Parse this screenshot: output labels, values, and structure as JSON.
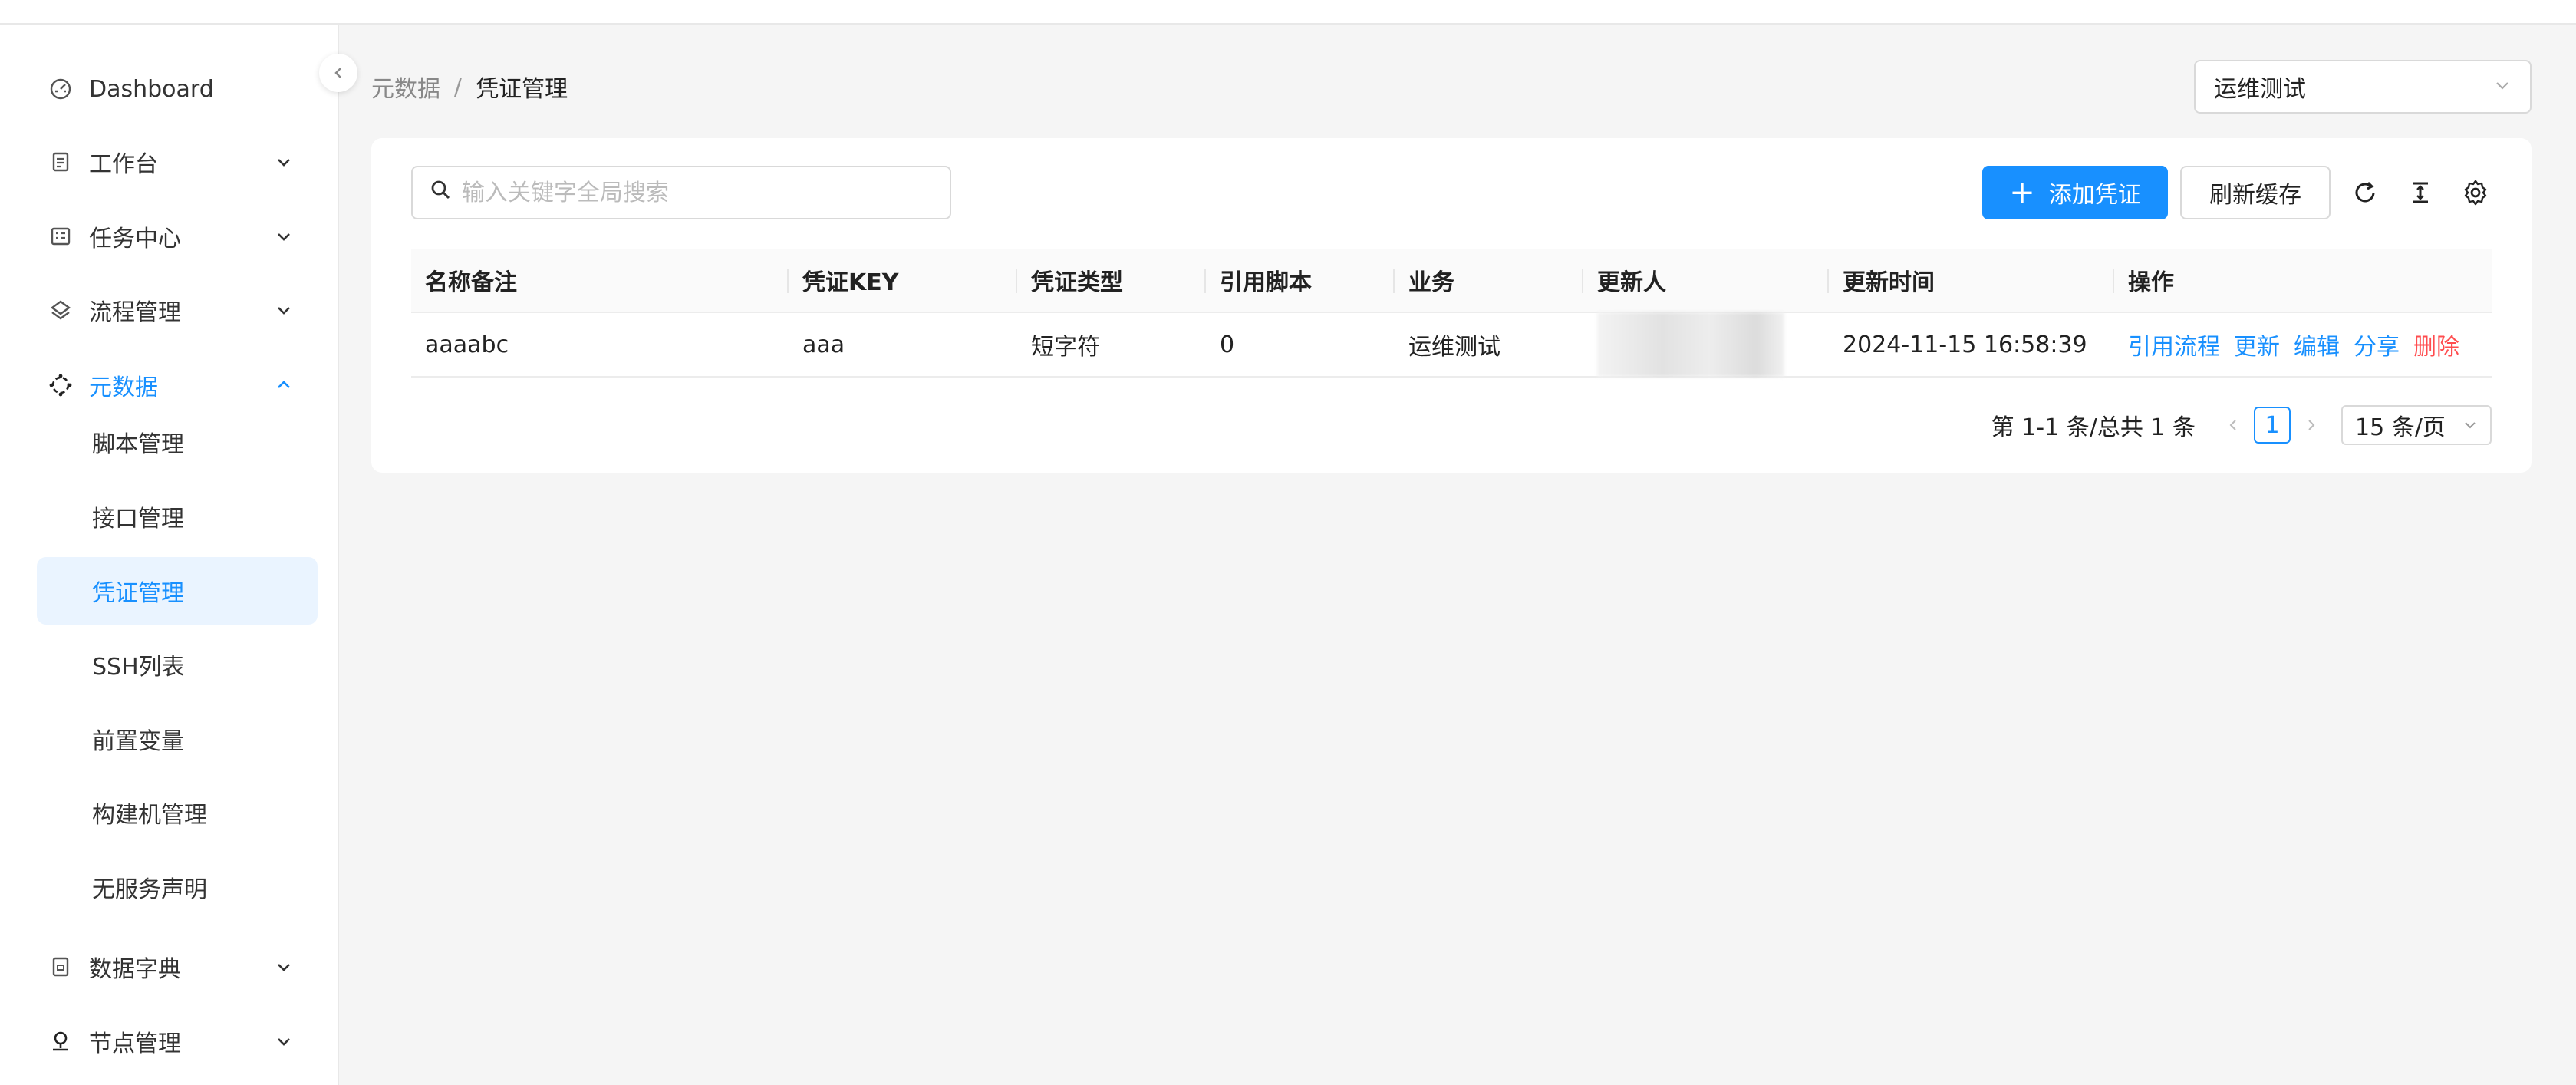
{
  "sidebar": {
    "items": [
      {
        "label": "Dashboard",
        "icon": "dashboard-icon",
        "expandable": false
      },
      {
        "label": "工作台",
        "icon": "document-icon",
        "expandable": true
      },
      {
        "label": "任务中心",
        "icon": "task-icon",
        "expandable": true
      },
      {
        "label": "流程管理",
        "icon": "flow-icon",
        "expandable": true
      },
      {
        "label": "元数据",
        "icon": "metadata-icon",
        "expandable": true,
        "expanded": true
      },
      {
        "label": "数据字典",
        "icon": "dictionary-icon",
        "expandable": true
      },
      {
        "label": "节点管理",
        "icon": "node-icon",
        "expandable": true
      }
    ],
    "sub_items": [
      {
        "label": "脚本管理"
      },
      {
        "label": "接口管理"
      },
      {
        "label": "凭证管理",
        "selected": true
      },
      {
        "label": "SSH列表"
      },
      {
        "label": "前置变量"
      },
      {
        "label": "构建机管理"
      },
      {
        "label": "无服务声明"
      }
    ]
  },
  "breadcrumb": {
    "parent": "元数据",
    "separator": "/",
    "current": "凭证管理"
  },
  "biz_select": {
    "value": "运维测试"
  },
  "toolbar": {
    "search_placeholder": "输入关键字全局搜索",
    "add_label": "添加凭证",
    "refresh_cache_label": "刷新缓存"
  },
  "table": {
    "headers": [
      "名称备注",
      "凭证KEY",
      "凭证类型",
      "引用脚本",
      "业务",
      "更新人",
      "更新时间",
      "操作"
    ],
    "rows": [
      {
        "name": "aaaabc",
        "key": "aaa",
        "type": "短字符",
        "ref_scripts": "0",
        "business": "运维测试",
        "updater": "",
        "updated_at": "2024-11-15 16:58:39",
        "actions": [
          "引用流程",
          "更新",
          "编辑",
          "分享",
          "删除"
        ]
      }
    ]
  },
  "pagination": {
    "total_text": "第 1-1 条/总共 1 条",
    "current_page": "1",
    "page_size": "15 条/页"
  },
  "colors": {
    "primary": "#1890ff",
    "danger": "#ff4d4f",
    "selected_bg": "#eaf4ff"
  }
}
